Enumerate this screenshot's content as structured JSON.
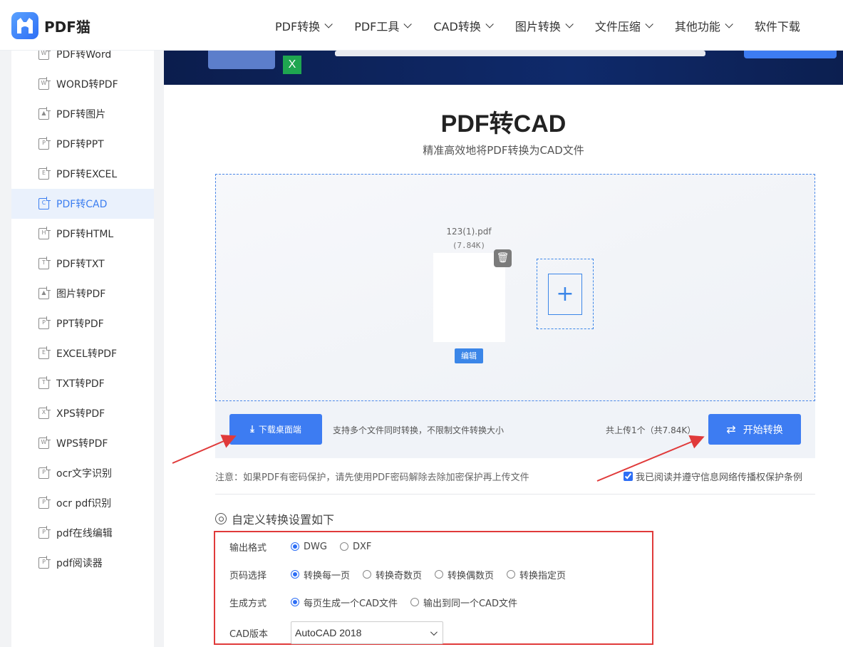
{
  "header": {
    "logo_text": "PDF猫",
    "nav": [
      "PDF转换",
      "PDF工具",
      "CAD转换",
      "图片转换",
      "文件压缩",
      "其他功能",
      "软件下载"
    ]
  },
  "sidebar": {
    "items": [
      {
        "label": "PDF转Word",
        "icon": "word-file-icon",
        "glyph": "W"
      },
      {
        "label": "WORD转PDF",
        "icon": "word-file-icon",
        "glyph": "W"
      },
      {
        "label": "PDF转图片",
        "icon": "image-file-icon",
        "glyph": "▲"
      },
      {
        "label": "PDF转PPT",
        "icon": "ppt-file-icon",
        "glyph": "P"
      },
      {
        "label": "PDF转EXCEL",
        "icon": "excel-file-icon",
        "glyph": "E"
      },
      {
        "label": "PDF转CAD",
        "icon": "cad-file-icon",
        "glyph": "C",
        "active": true
      },
      {
        "label": "PDF转HTML",
        "icon": "html-file-icon",
        "glyph": "H"
      },
      {
        "label": "PDF转TXT",
        "icon": "txt-file-icon",
        "glyph": "T"
      },
      {
        "label": "图片转PDF",
        "icon": "image-file-icon",
        "glyph": "▲"
      },
      {
        "label": "PPT转PDF",
        "icon": "ppt-file-icon",
        "glyph": "P"
      },
      {
        "label": "EXCEL转PDF",
        "icon": "excel-file-icon",
        "glyph": "E"
      },
      {
        "label": "TXT转PDF",
        "icon": "txt-file-icon",
        "glyph": "T"
      },
      {
        "label": "XPS转PDF",
        "icon": "xps-file-icon",
        "glyph": "X"
      },
      {
        "label": "WPS转PDF",
        "icon": "wps-file-icon",
        "glyph": "W"
      },
      {
        "label": "ocr文字识别",
        "icon": "pdf-file-icon",
        "glyph": "P"
      },
      {
        "label": "ocr pdf识别",
        "icon": "pdf-file-icon",
        "glyph": "P"
      },
      {
        "label": "pdf在线编辑",
        "icon": "pdf-file-icon",
        "glyph": "P"
      },
      {
        "label": "pdf阅读器",
        "icon": "pdf-file-icon",
        "glyph": "P"
      }
    ]
  },
  "banner": {
    "badge": "X"
  },
  "main": {
    "title": "PDF转CAD",
    "subtitle": "精准高效地将PDF转换为CAD文件"
  },
  "upload": {
    "file_name": "123(1).pdf",
    "file_size": "(7.84K)",
    "edit_label": "编辑",
    "trash_glyph": "🗑",
    "add_glyph": "+"
  },
  "actions": {
    "download_label": "下载桌面端",
    "support_text": "支持多个文件同时转换，不限制文件转换大小",
    "count_text": "共上传1个（共7.84K）",
    "start_label": "开始转换"
  },
  "notice": {
    "text": "注意：如果PDF有密码保护，请先使用PDF密码解除去除加密保护再上传文件",
    "agree_text": "我已阅读并遵守信息网络传播权保护条例",
    "agree_checked": true
  },
  "settings": {
    "heading": "自定义转换设置如下",
    "output_format": {
      "label": "输出格式",
      "options": [
        "DWG",
        "DXF"
      ],
      "selected": "DWG"
    },
    "page_select": {
      "label": "页码选择",
      "options": [
        "转换每一页",
        "转换奇数页",
        "转换偶数页",
        "转换指定页"
      ],
      "selected": "转换每一页"
    },
    "generate_mode": {
      "label": "生成方式",
      "options": [
        "每页生成一个CAD文件",
        "输出到同一个CAD文件"
      ],
      "selected": "每页生成一个CAD文件"
    },
    "cad_version": {
      "label": "CAD版本",
      "value": "AutoCAD 2018"
    }
  },
  "colors": {
    "accent": "#3d7cf2",
    "annotation": "#e03a3a"
  }
}
